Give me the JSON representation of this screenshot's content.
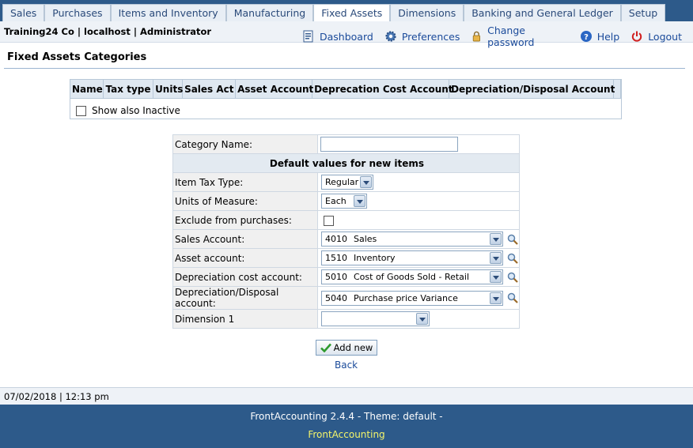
{
  "tabs": [
    {
      "label": "Sales",
      "active": false
    },
    {
      "label": "Purchases",
      "active": false
    },
    {
      "label": "Items and Inventory",
      "active": false
    },
    {
      "label": "Manufacturing",
      "active": false
    },
    {
      "label": "Fixed Assets",
      "active": true
    },
    {
      "label": "Dimensions",
      "active": false
    },
    {
      "label": "Banking and General Ledger",
      "active": false
    },
    {
      "label": "Setup",
      "active": false
    }
  ],
  "user_info": "Training24 Co | localhost | Administrator",
  "top_links": {
    "dashboard": "Dashboard",
    "preferences": "Preferences",
    "change_password": "Change password",
    "help": "Help",
    "logout": "Logout"
  },
  "page_title": "Fixed Assets Categories",
  "list": {
    "columns": [
      "Name",
      "Tax type",
      "Units",
      "Sales Act",
      "Asset Account",
      "Deprecation Cost Account",
      "Depreciation/Disposal Account"
    ],
    "show_inactive_label": "Show also Inactive"
  },
  "form": {
    "category_name_label": "Category Name:",
    "category_name_value": "",
    "section_header": "Default values for new items",
    "item_tax_type_label": "Item Tax Type:",
    "item_tax_type_value": "Regular",
    "units_label": "Units of Measure:",
    "units_value": "Each",
    "exclude_label": "Exclude from purchases:",
    "sales_account_label": "Sales Account:",
    "sales_account_code": "4010",
    "sales_account_name": "Sales",
    "asset_account_label": "Asset account:",
    "asset_account_code": "1510",
    "asset_account_name": "Inventory",
    "dep_cost_label": "Depreciation cost account:",
    "dep_cost_code": "5010",
    "dep_cost_name": "Cost of Goods Sold - Retail",
    "dep_disp_label": "Depreciation/Disposal account:",
    "dep_disp_code": "5040",
    "dep_disp_name": "Purchase price Variance",
    "dimension_label": "Dimension 1",
    "dimension_value": ""
  },
  "buttons": {
    "add_new": "Add new",
    "back": "Back"
  },
  "status_bar": "07/02/2018 | 12:13 pm",
  "footer": {
    "version": "FrontAccounting 2.4.4 - Theme: default -",
    "link": "FrontAccounting"
  },
  "colors": {
    "page_background": "#2d5a8a",
    "footer_link": "#f5f56a",
    "link": "#1a4a9a"
  },
  "icons": {
    "dashboard": "dashboard-icon",
    "preferences": "gear-icon",
    "change_password": "lock-icon",
    "help": "help-icon",
    "logout": "power-icon",
    "account_search": "magnifier-icon",
    "add_new": "checkmark-icon"
  }
}
